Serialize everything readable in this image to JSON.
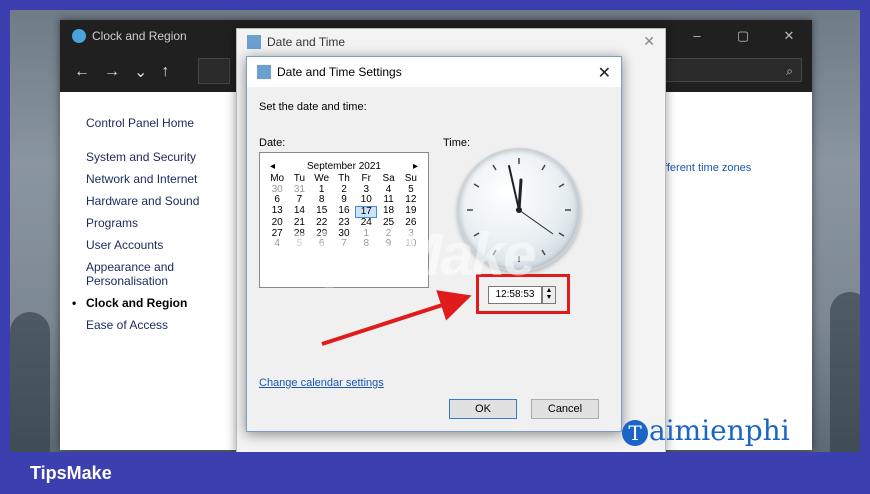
{
  "control_panel": {
    "title": "Clock and Region",
    "window_controls": [
      "–",
      "▢",
      "✕"
    ],
    "nav": [
      "←",
      "→",
      "⌄",
      "↑"
    ],
    "search_icon": "⌕",
    "sidebar": [
      {
        "label": "Control Panel Home"
      },
      {
        "label": "System and Security"
      },
      {
        "label": "Network and Internet"
      },
      {
        "label": "Hardware and Sound"
      },
      {
        "label": "Programs"
      },
      {
        "label": "User Accounts"
      },
      {
        "label": "Appearance and Personalisation"
      },
      {
        "label": "Clock and Region"
      },
      {
        "label": "Ease of Access"
      }
    ],
    "tz_link": "fferent time zones",
    "partial_text": "ock"
  },
  "date_time_window": {
    "title": "Date and Time",
    "close": "✕"
  },
  "dialog": {
    "title": "Date and Time Settings",
    "close": "✕",
    "instruction": "Set the date and time:",
    "date_label": "Date:",
    "time_label": "Time:",
    "calendar": {
      "month": "September 2021",
      "prev": "◂",
      "next": "▸",
      "weekdays": [
        "Mo",
        "Tu",
        "We",
        "Th",
        "Fr",
        "Sa",
        "Su"
      ],
      "days": [
        "30",
        "31",
        "1",
        "2",
        "3",
        "4",
        "5",
        "6",
        "7",
        "8",
        "9",
        "10",
        "11",
        "12",
        "13",
        "14",
        "15",
        "16",
        "17",
        "18",
        "19",
        "20",
        "21",
        "22",
        "23",
        "24",
        "25",
        "26",
        "27",
        "28",
        "29",
        "30",
        "1",
        "2",
        "3",
        "4",
        "5",
        "6",
        "7",
        "8",
        "9",
        "10"
      ],
      "selected": "17"
    },
    "time_value": "12:58:53",
    "change_calendar_link": "Change calendar settings",
    "ok_label": "OK",
    "cancel_label": "Cancel"
  },
  "watermark": "TipsMake",
  "brand": {
    "letter": "T",
    "text": "aimienphi"
  },
  "footer": "TipsMake",
  "colors": {
    "highlight": "#e01b1b",
    "accent": "#3b3fb0"
  }
}
